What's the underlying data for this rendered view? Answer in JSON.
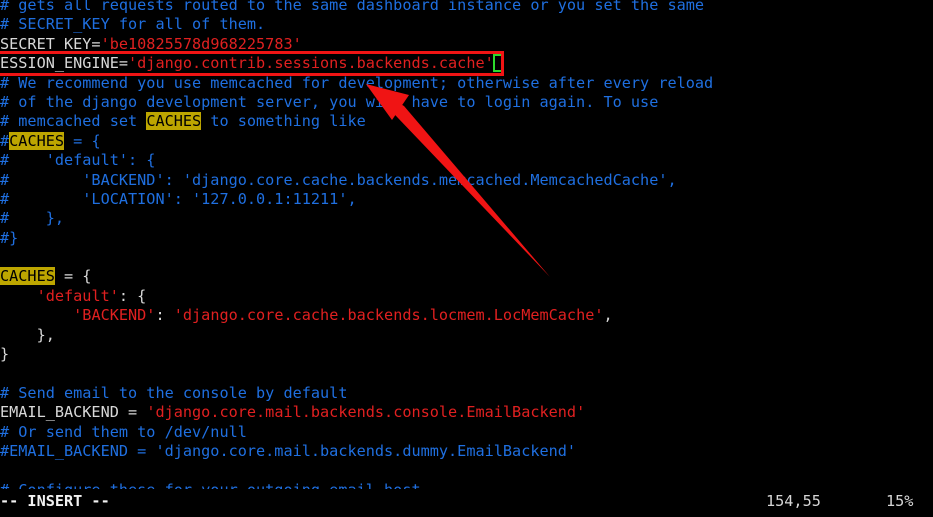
{
  "editor": {
    "name": "vim",
    "background": "#000000",
    "comment_color": "#1f6fe0",
    "string_color": "#e02020",
    "text_color": "#d8d8d8",
    "search_highlight_bg": "#bda600",
    "cursor_outline_color": "#2ddb2d",
    "annotation_color": "#f01414"
  },
  "lines": [
    {
      "segments": [
        {
          "text": "# gets all requests routed to the same dashboard instance or you set the same",
          "cls": "cmt"
        }
      ]
    },
    {
      "segments": [
        {
          "text": "# SECRET_KEY for all of them.",
          "cls": "cmt"
        }
      ]
    },
    {
      "segments": [
        {
          "text": "SECRET_KEY=",
          "cls": "ident"
        },
        {
          "text": "'be10825578d968225783'",
          "cls": "str"
        }
      ]
    },
    {
      "segments": [
        {
          "text": "ESSION_ENGINE=",
          "cls": "ident"
        },
        {
          "text": "'django.contrib.sessions.backends.cache'",
          "cls": "str"
        },
        {
          "text": "",
          "cls": "cursor"
        }
      ]
    },
    {
      "segments": [
        {
          "text": "# We recommend you use memcached for development; otherwise after every reload",
          "cls": "cmt"
        }
      ]
    },
    {
      "segments": [
        {
          "text": "# of the django development server, you will have to login again. To use",
          "cls": "cmt"
        }
      ]
    },
    {
      "segments": [
        {
          "text": "# memcached set ",
          "cls": "cmt"
        },
        {
          "text": "CACHES",
          "cls": "hl"
        },
        {
          "text": " to something like",
          "cls": "cmt"
        }
      ]
    },
    {
      "segments": [
        {
          "text": "#",
          "cls": "cmt"
        },
        {
          "text": "CACHES",
          "cls": "hl"
        },
        {
          "text": " = {",
          "cls": "cmt"
        }
      ]
    },
    {
      "segments": [
        {
          "text": "#    'default': {",
          "cls": "cmt"
        }
      ]
    },
    {
      "segments": [
        {
          "text": "#        'BACKEND': 'django.core.cache.backends.memcached.MemcachedCache',",
          "cls": "cmt"
        }
      ]
    },
    {
      "segments": [
        {
          "text": "#        'LOCATION': '127.0.0.1:11211',",
          "cls": "cmt"
        }
      ]
    },
    {
      "segments": [
        {
          "text": "#    },",
          "cls": "cmt"
        }
      ]
    },
    {
      "segments": [
        {
          "text": "#}",
          "cls": "cmt"
        }
      ]
    },
    {
      "segments": [
        {
          "text": "",
          "cls": "cmt"
        }
      ]
    },
    {
      "segments": [
        {
          "text": "CACHES",
          "cls": "hl"
        },
        {
          "text": " = {",
          "cls": "punct"
        }
      ]
    },
    {
      "segments": [
        {
          "text": "    ",
          "cls": "punct"
        },
        {
          "text": "'default'",
          "cls": "str"
        },
        {
          "text": ": {",
          "cls": "punct"
        }
      ]
    },
    {
      "segments": [
        {
          "text": "        ",
          "cls": "punct"
        },
        {
          "text": "'BACKEND'",
          "cls": "str"
        },
        {
          "text": ": ",
          "cls": "punct"
        },
        {
          "text": "'django.core.cache.backends.locmem.LocMemCache'",
          "cls": "str"
        },
        {
          "text": ",",
          "cls": "punct"
        }
      ]
    },
    {
      "segments": [
        {
          "text": "    },",
          "cls": "punct"
        }
      ]
    },
    {
      "segments": [
        {
          "text": "}",
          "cls": "punct"
        }
      ]
    },
    {
      "segments": [
        {
          "text": "",
          "cls": "punct"
        }
      ]
    },
    {
      "segments": [
        {
          "text": "# Send email to the console by default",
          "cls": "cmt"
        }
      ]
    },
    {
      "segments": [
        {
          "text": "EMAIL_BACKEND = ",
          "cls": "ident"
        },
        {
          "text": "'django.core.mail.backends.console.EmailBackend'",
          "cls": "str"
        }
      ]
    },
    {
      "segments": [
        {
          "text": "# Or send them to /dev/null",
          "cls": "cmt"
        }
      ]
    },
    {
      "segments": [
        {
          "text": "#EMAIL_BACKEND = 'django.core.mail.backends.dummy.EmailBackend'",
          "cls": "cmt"
        }
      ]
    },
    {
      "segments": [
        {
          "text": "",
          "cls": "cmt"
        }
      ]
    },
    {
      "segments": [
        {
          "text": "# Configure these for your outgoing email host",
          "cls": "cmt"
        }
      ]
    }
  ],
  "status": {
    "mode": "-- INSERT --",
    "ruler": "154,55",
    "percent": "15%"
  },
  "annotations": {
    "highlight_box_target": "SESSION_ENGINE line",
    "arrow_label": "red-arrow-pointing-to-session-engine-line"
  }
}
